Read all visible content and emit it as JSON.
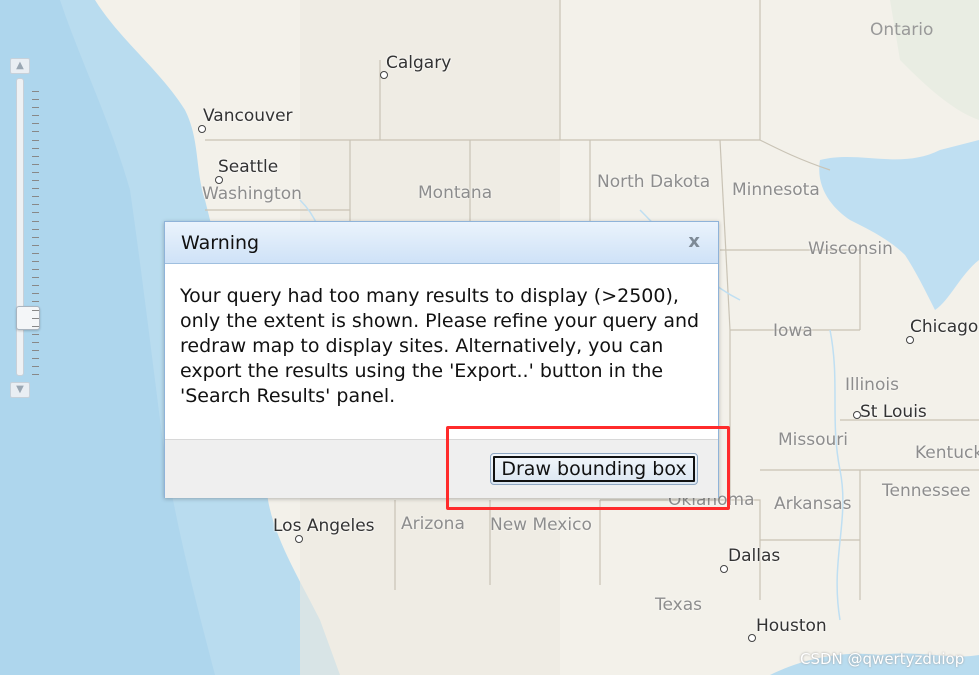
{
  "map": {
    "cities": [
      {
        "name": "Calgary"
      },
      {
        "name": "Vancouver"
      },
      {
        "name": "Seattle"
      },
      {
        "name": "Chicago"
      },
      {
        "name": "St Louis"
      },
      {
        "name": "Los Angeles"
      },
      {
        "name": "Dallas"
      },
      {
        "name": "Houston"
      }
    ],
    "regions": [
      {
        "name": "Ontario"
      },
      {
        "name": "Washington"
      },
      {
        "name": "Montana"
      },
      {
        "name": "North Dakota"
      },
      {
        "name": "Minnesota"
      },
      {
        "name": "Wisconsin"
      },
      {
        "name": "Iowa"
      },
      {
        "name": "Illinois"
      },
      {
        "name": "Missouri"
      },
      {
        "name": "Kentucky"
      },
      {
        "name": "Tennessee"
      },
      {
        "name": "Arkansas"
      },
      {
        "name": "Oklahoma"
      },
      {
        "name": "Arizona"
      },
      {
        "name": "New Mexico"
      },
      {
        "name": "Texas"
      }
    ],
    "colors": {
      "land": "#f3f1ea",
      "water": "#b9dcef",
      "lake": "#bfdff2",
      "border": "#c9c3b5"
    }
  },
  "zoom": {
    "up_icon": "▲",
    "down_icon": "▼",
    "level_fraction": 0.17
  },
  "dialog": {
    "title": "Warning",
    "close_icon": "x",
    "message": "Your query had too many results to display (>2500), only the extent is shown. Please refine your query and redraw map to display sites. Alternatively, you can export the results using the 'Export..' button in the 'Search Results' panel.",
    "button_label": "Draw bounding box"
  },
  "highlight_color": "#ff2b2b",
  "watermark": "CSDN @qwertyzduiop"
}
